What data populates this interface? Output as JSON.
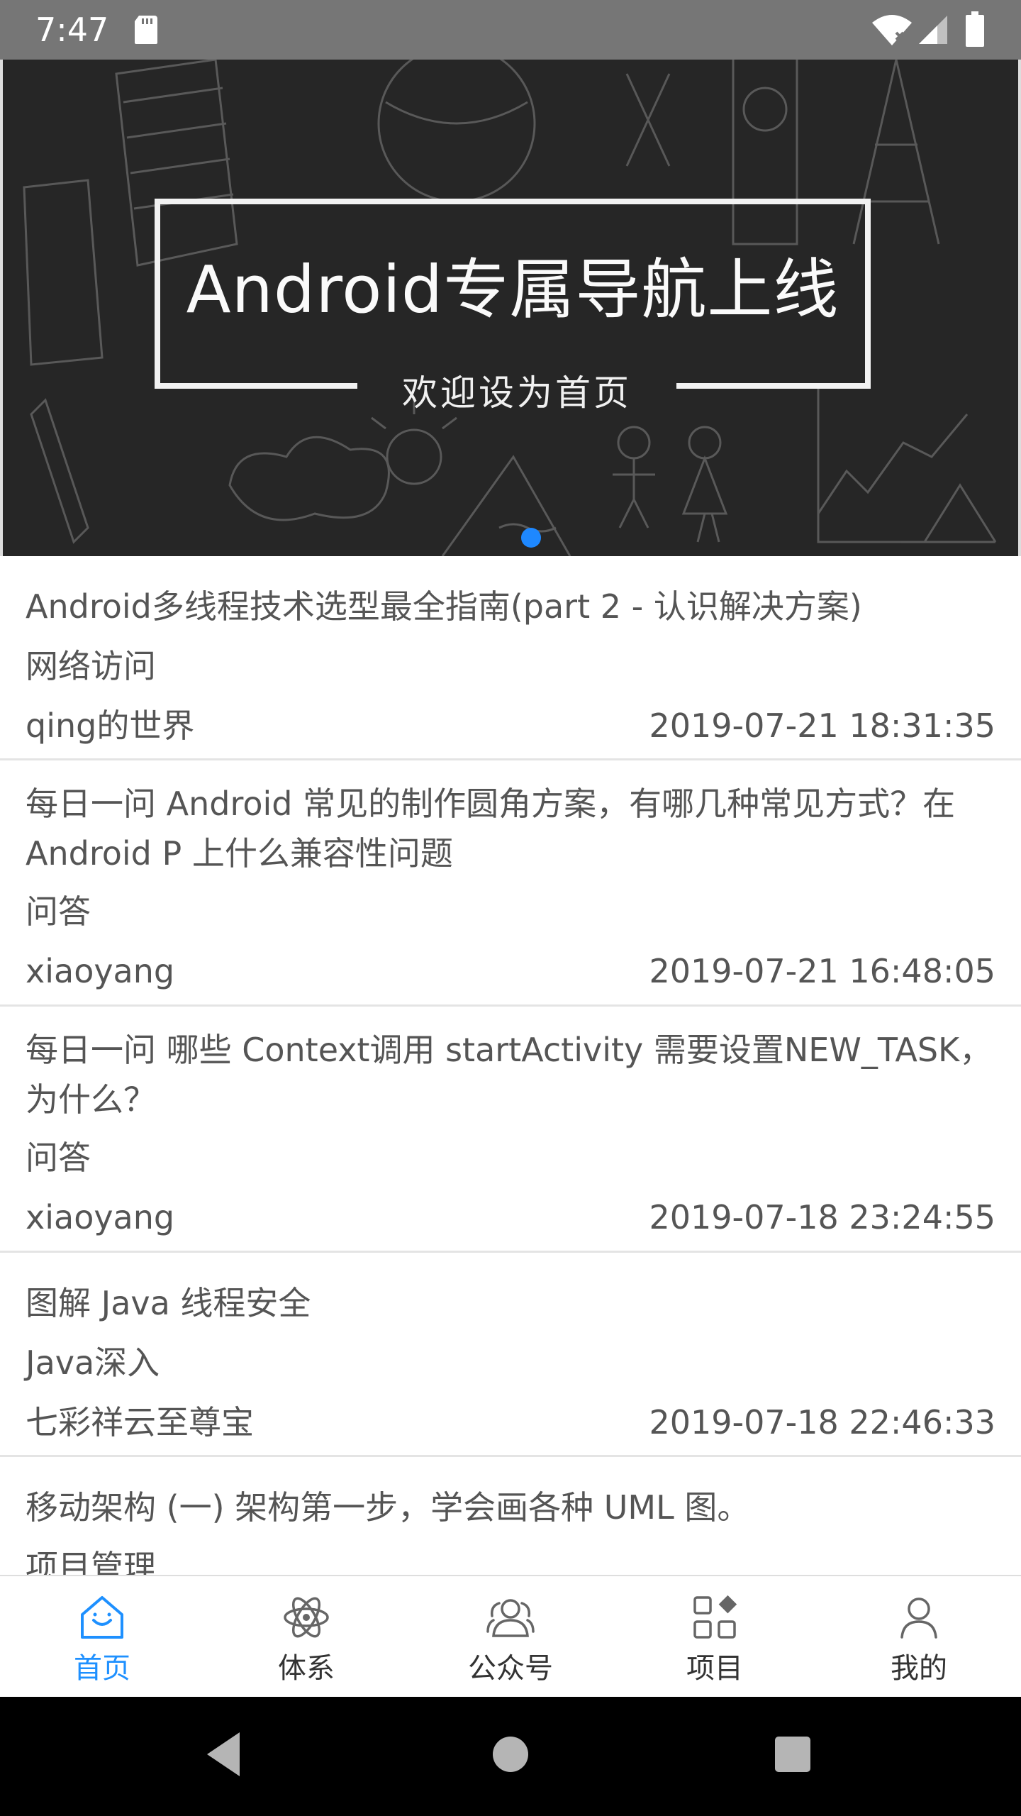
{
  "status_bar": {
    "time": "7:47",
    "icons": [
      "sd-card-icon",
      "wifi-icon",
      "signal-icon",
      "battery-icon"
    ]
  },
  "banner": {
    "title": "Android专属导航上线",
    "subtitle": "欢迎设为首页",
    "indicator_count": 1,
    "indicator_active": 0,
    "indicator_color": "#1e88ff"
  },
  "articles": [
    {
      "title": "Android多线程技术选型最全指南(part 2 - 认识解决方案)",
      "category": "网络访问",
      "author": "qing的世界",
      "date": "2019-07-21 18:31:35"
    },
    {
      "title": "每日一问 Android 常见的制作圆角方案，有哪几种常见方式？在Android P 上什么兼容性问题",
      "category": "问答",
      "author": "xiaoyang",
      "date": "2019-07-21 16:48:05"
    },
    {
      "title": "每日一问 哪些 Context调用 startActivity 需要设置NEW_TASK，为什么？",
      "category": "问答",
      "author": "xiaoyang",
      "date": "2019-07-18 23:24:55"
    },
    {
      "title": "图解 Java 线程安全",
      "category": "Java深入",
      "author": " 七彩祥云至尊宝",
      "date": "2019-07-18 22:46:33"
    },
    {
      "title": "移动架构 (一) 架构第一步，学会画各种 UML 图。",
      "category": "项目管理",
      "author": "",
      "date": ""
    }
  ],
  "bottom_nav": {
    "active_color": "#1e90ff",
    "items": [
      {
        "label": "首页",
        "icon": "home-icon",
        "active": true
      },
      {
        "label": "体系",
        "icon": "atom-icon",
        "active": false
      },
      {
        "label": "公众号",
        "icon": "people-icon",
        "active": false
      },
      {
        "label": "项目",
        "icon": "grid-icon",
        "active": false
      },
      {
        "label": "我的",
        "icon": "person-icon",
        "active": false
      }
    ]
  },
  "system_nav": {
    "buttons": [
      "back-icon",
      "home-circle-icon",
      "recents-icon"
    ]
  }
}
